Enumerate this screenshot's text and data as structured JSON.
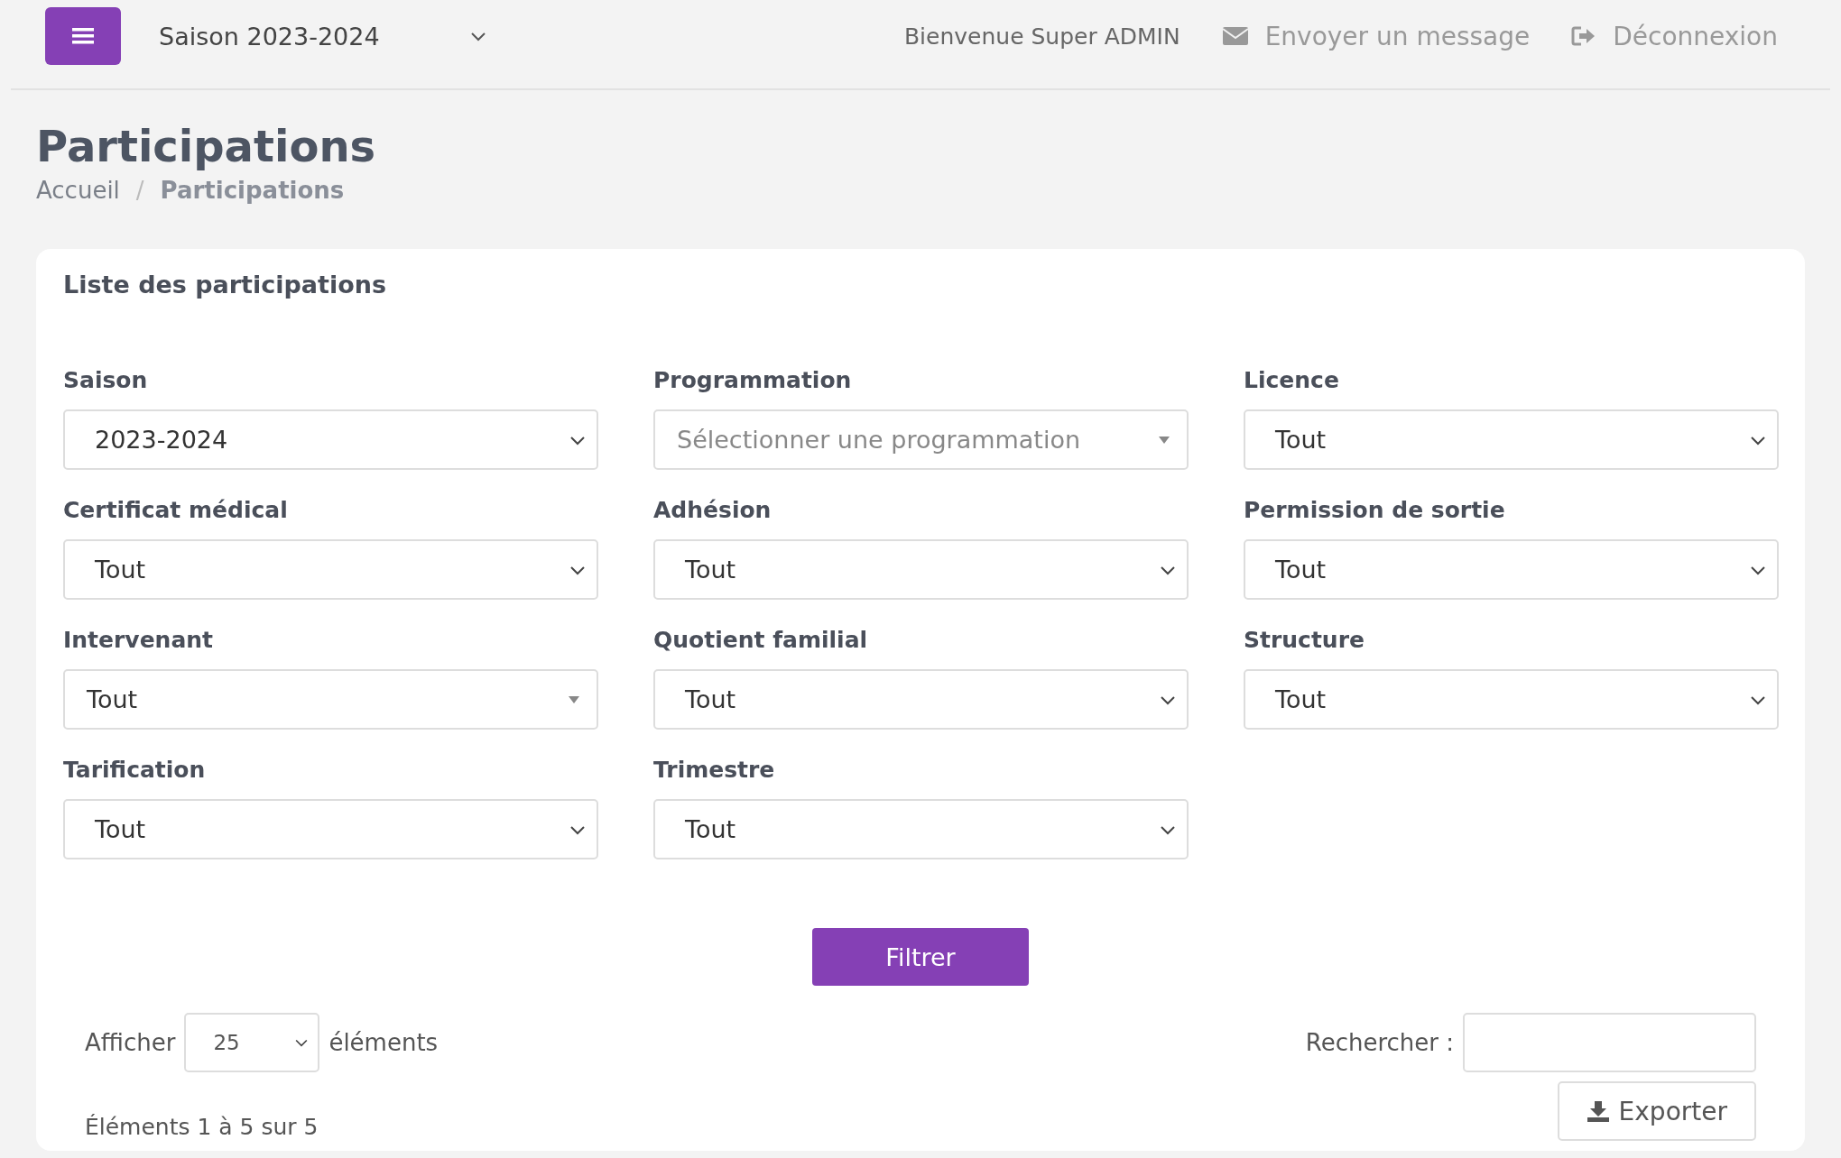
{
  "header": {
    "season": "Saison 2023-2024",
    "welcome": "Bienvenue Super ADMIN",
    "links": [
      {
        "kind": "message",
        "label": "Envoyer un message"
      },
      {
        "kind": "logout",
        "label": "Déconnexion"
      }
    ]
  },
  "page": {
    "title": "Participations",
    "breadcrumb_separator": "/",
    "breadcrumb": [
      {
        "label": "Accueil",
        "selected": false
      },
      {
        "label": "Participations",
        "selected": true
      }
    ]
  },
  "card": {
    "title": "Liste des participations",
    "filters": [
      {
        "label": "Saison",
        "kind": "native",
        "value": "2023-2024"
      },
      {
        "label": "Programmation",
        "kind": "select2",
        "placeholder": "Sélectionner une programmation"
      },
      {
        "label": "Licence",
        "kind": "native",
        "value": "Tout"
      },
      {
        "label": "Certificat médical",
        "kind": "native",
        "value": "Tout"
      },
      {
        "label": "Adhésion",
        "kind": "native",
        "value": "Tout"
      },
      {
        "label": "Permission de sortie",
        "kind": "native",
        "value": "Tout"
      },
      {
        "label": "Intervenant",
        "kind": "select2",
        "value": "Tout"
      },
      {
        "label": "Quotient familial",
        "kind": "native",
        "value": "Tout"
      },
      {
        "label": "Structure",
        "kind": "native",
        "value": "Tout"
      },
      {
        "label": "Tarification",
        "kind": "native",
        "value": "Tout"
      },
      {
        "label": "Trimestre",
        "kind": "native",
        "value": "Tout"
      }
    ],
    "filter_button": "Filtrer",
    "length": {
      "before": "Afficher",
      "value": "25",
      "after": "éléments"
    },
    "search": {
      "label": "Rechercher :"
    },
    "info": "Éléments 1 à 5 sur 5",
    "export_button": "Exporter"
  }
}
